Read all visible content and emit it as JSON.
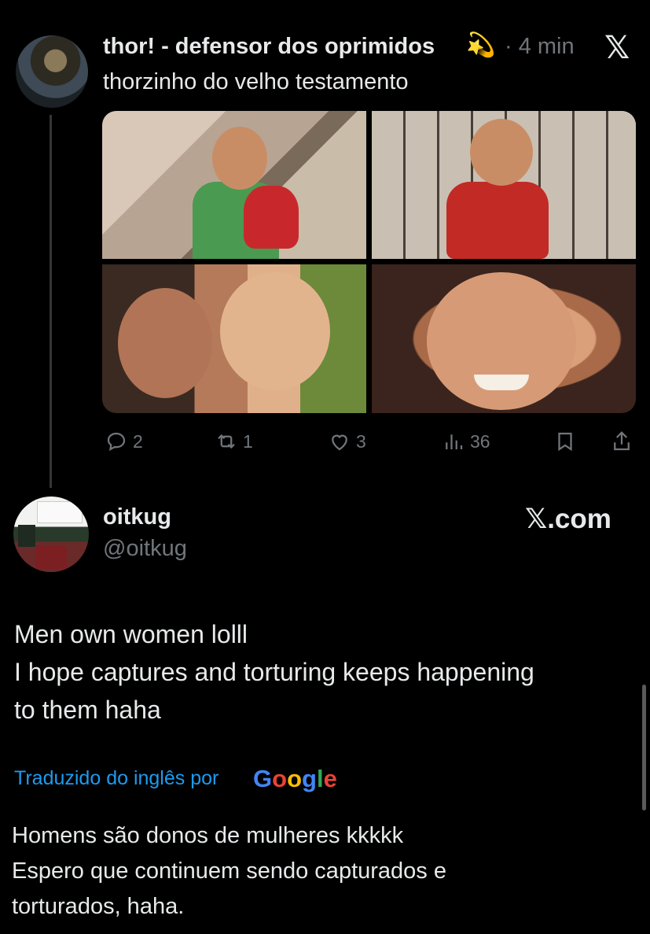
{
  "quoted_tweet": {
    "author_name": "thor! - defensor dos oprimidos",
    "author_emoji": "💫",
    "time": "· 4 min",
    "text": "thorzinho do velho testamento",
    "close_icon": "x-logo-icon",
    "actions": {
      "replies": "2",
      "retweets": "1",
      "likes": "3",
      "views": "36"
    }
  },
  "reply_tweet": {
    "author_name": "oitkug",
    "handle": "@oitkug",
    "site_badge": "𝕏.com",
    "original_text": [
      "Men own women lolll",
      "I hope captures and torturing keeps happening",
      "to them haha"
    ],
    "translation_label": "Traduzido do inglês por",
    "translation_provider": "Google",
    "translated_text": [
      "Homens são donos de mulheres kkkkk",
      "Espero que continuem sendo capturados e",
      "torturados, haha."
    ]
  },
  "colors": {
    "background": "#000000",
    "text": "#e7e9ea",
    "muted": "#71767b",
    "link": "#1d9bf0"
  }
}
